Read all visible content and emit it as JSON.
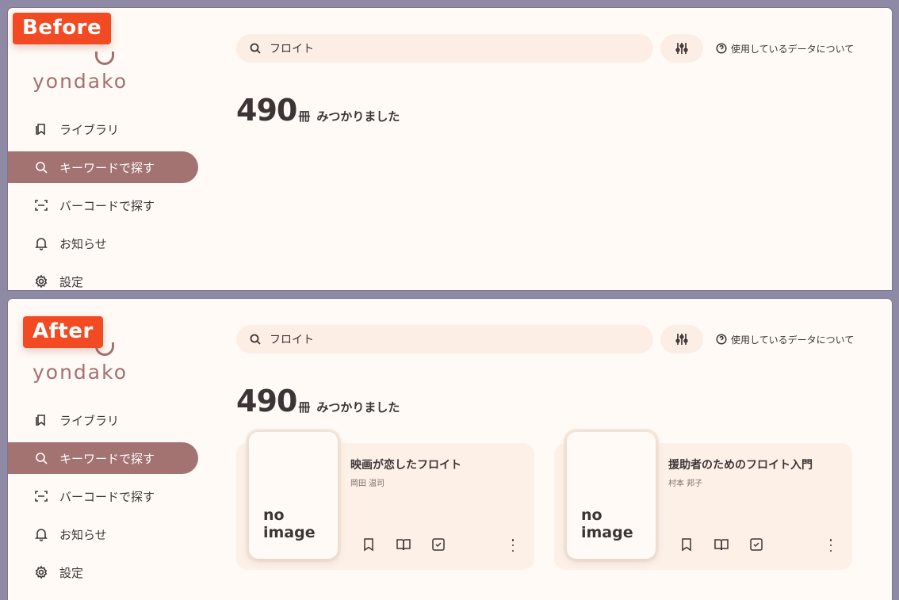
{
  "badges": {
    "before": "Before",
    "after": "After"
  },
  "app": {
    "logo": "yondako"
  },
  "sidebar": {
    "items": [
      {
        "label": "ライブラリ",
        "icon": "library-icon"
      },
      {
        "label": "キーワードで探す",
        "icon": "search-icon",
        "active": true
      },
      {
        "label": "バーコードで探す",
        "icon": "barcode-scan-icon"
      },
      {
        "label": "お知らせ",
        "icon": "bell-icon"
      },
      {
        "label": "設定",
        "icon": "gear-icon"
      }
    ]
  },
  "search": {
    "value": "フロイト"
  },
  "help": {
    "label": "使用しているデータについて"
  },
  "results": {
    "count": "490",
    "unit": "冊",
    "text": "みつかりました"
  },
  "books": [
    {
      "title": "映画が恋したフロイト",
      "author": "岡田 温司",
      "cover": "no\nimage"
    },
    {
      "title": "援助者のためのフロイト入門",
      "author": "村本 邦子",
      "cover": "no\nimage"
    }
  ],
  "colors": {
    "accent": "#a37371",
    "badge": "#f24b23",
    "surface": "#fdeee5",
    "background": "#fffaf6"
  }
}
